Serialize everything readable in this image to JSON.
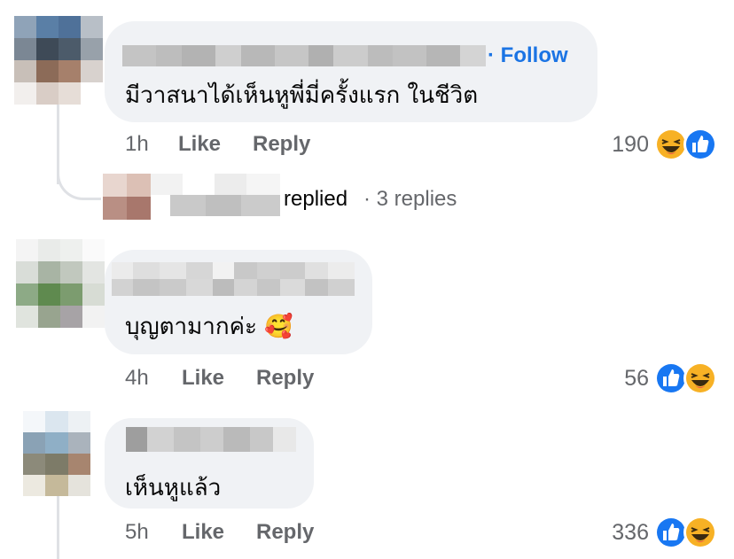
{
  "comments": [
    {
      "text": "มีวาสนาได้เห็นหูพี่มี่ครั้งแรก ในชีวิต",
      "follow_label": "· Follow",
      "time": "1h",
      "like_label": "Like",
      "reply_label": "Reply",
      "reaction_count": "190",
      "reactions": [
        "haha-icon",
        "like-icon"
      ]
    },
    {
      "text": "บุญตามากค่ะ 🥰",
      "time": "4h",
      "like_label": "Like",
      "reply_label": "Reply",
      "reaction_count": "56",
      "reactions": [
        "like-icon",
        "haha-icon"
      ]
    },
    {
      "text": "เห็นหูแล้ว",
      "time": "5h",
      "like_label": "Like",
      "reply_label": "Reply",
      "reaction_count": "336",
      "reactions": [
        "like-icon",
        "haha-icon"
      ]
    }
  ],
  "reply_summary": {
    "replied_label": "replied",
    "replies_count": "· 3 replies"
  },
  "colors": {
    "bubble": "#f0f2f5",
    "link": "#1b74e4",
    "meta": "#65676b",
    "like": "#1877f2",
    "haha": "#f7b125"
  }
}
